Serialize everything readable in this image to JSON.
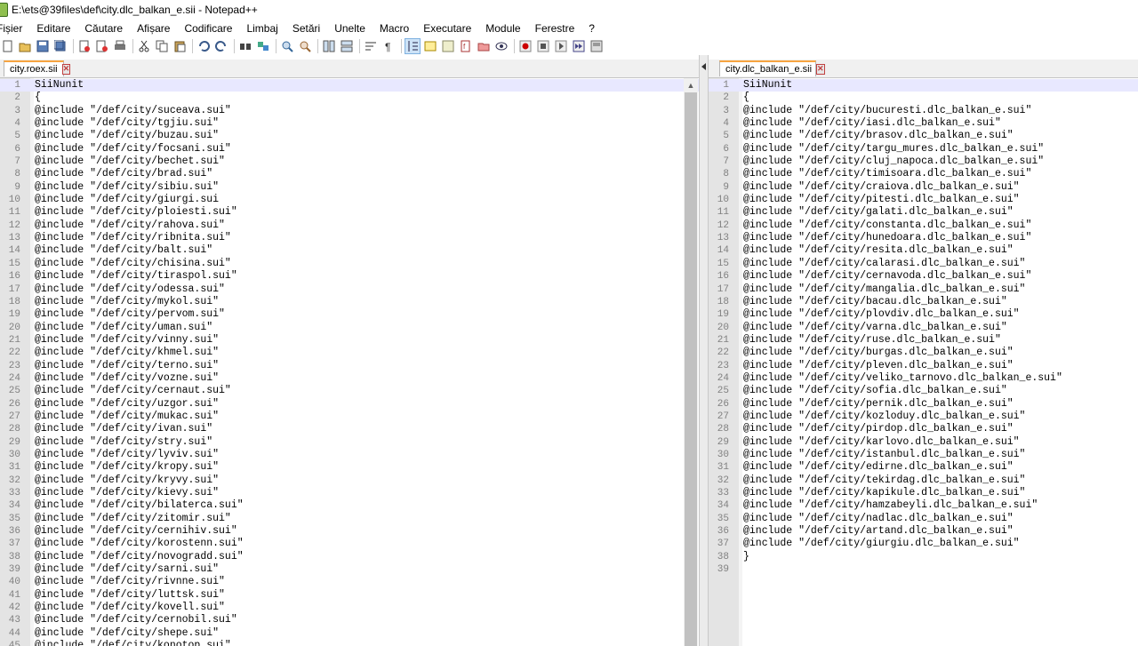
{
  "window": {
    "title": "E:\\ets@39files\\def\\city.dlc_balkan_e.sii - Notepad++"
  },
  "menu": [
    "Fișier",
    "Editare",
    "Căutare",
    "Afișare",
    "Codificare",
    "Limbaj",
    "Setări",
    "Unelte",
    "Macro",
    "Executare",
    "Module",
    "Ferestre",
    "?"
  ],
  "toolbar": [
    "new-icon",
    "open-icon",
    "save-icon",
    "save-all-icon",
    "close-icon",
    "close-all-icon",
    "print-icon",
    "cut-icon",
    "copy-icon",
    "paste-icon",
    "undo-icon",
    "redo-icon",
    "find-icon",
    "replace-icon",
    "zoom-in-icon",
    "zoom-out-icon",
    "sync-vertical-icon",
    "sync-horizontal-icon",
    "word-wrap-icon",
    "show-all-chars-icon",
    "indent-guide-icon",
    "udl-icon",
    "doc-map-icon",
    "function-list-icon",
    "folder-workspace-icon",
    "monitoring-icon",
    "record-macro-icon",
    "stop-macro-icon",
    "play-macro-icon",
    "run-macro-multiple-icon",
    "save-macro-icon"
  ],
  "left_pane": {
    "tab": "city.roex.sii",
    "lines": [
      "SiiNunit",
      "{",
      "@include \"/def/city/suceava.sui\"",
      "@include \"/def/city/tgjiu.sui\"",
      "@include \"/def/city/buzau.sui\"",
      "@include \"/def/city/focsani.sui\"",
      "@include \"/def/city/bechet.sui\"",
      "@include \"/def/city/brad.sui\"",
      "@include \"/def/city/sibiu.sui\"",
      "@include \"/def/city/giurgi.sui",
      "@include \"/def/city/ploiesti.sui\"",
      "@include \"/def/city/rahova.sui\"",
      "@include \"/def/city/ribnita.sui\"",
      "@include \"/def/city/balt.sui\"",
      "@include \"/def/city/chisina.sui\"",
      "@include \"/def/city/tiraspol.sui\"",
      "@include \"/def/city/odessa.sui\"",
      "@include \"/def/city/mykol.sui\"",
      "@include \"/def/city/pervom.sui\"",
      "@include \"/def/city/uman.sui\"",
      "@include \"/def/city/vinny.sui\"",
      "@include \"/def/city/khmel.sui\"",
      "@include \"/def/city/terno.sui\"",
      "@include \"/def/city/vozne.sui\"",
      "@include \"/def/city/cernaut.sui\"",
      "@include \"/def/city/uzgor.sui\"",
      "@include \"/def/city/mukac.sui\"",
      "@include \"/def/city/ivan.sui\"",
      "@include \"/def/city/stry.sui\"",
      "@include \"/def/city/lyviv.sui\"",
      "@include \"/def/city/kropy.sui\"",
      "@include \"/def/city/kryvy.sui\"",
      "@include \"/def/city/kievy.sui\"",
      "@include \"/def/city/bilaterca.sui\"",
      "@include \"/def/city/zitomir.sui\"",
      "@include \"/def/city/cernihiv.sui\"",
      "@include \"/def/city/korostenn.sui\"",
      "@include \"/def/city/novogradd.sui\"",
      "@include \"/def/city/sarni.sui\"",
      "@include \"/def/city/rivnne.sui\"",
      "@include \"/def/city/luttsk.sui\"",
      "@include \"/def/city/kovell.sui\"",
      "@include \"/def/city/cernobil.sui\"",
      "@include \"/def/city/shepe.sui\"",
      "@include \"/def/city/konotop.sui\""
    ]
  },
  "right_pane": {
    "tab": "city.dlc_balkan_e.sii",
    "lines": [
      "SiiNunit",
      "{",
      "@include \"/def/city/bucuresti.dlc_balkan_e.sui\"",
      "@include \"/def/city/iasi.dlc_balkan_e.sui\"",
      "@include \"/def/city/brasov.dlc_balkan_e.sui\"",
      "@include \"/def/city/targu_mures.dlc_balkan_e.sui\"",
      "@include \"/def/city/cluj_napoca.dlc_balkan_e.sui\"",
      "@include \"/def/city/timisoara.dlc_balkan_e.sui\"",
      "@include \"/def/city/craiova.dlc_balkan_e.sui\"",
      "@include \"/def/city/pitesti.dlc_balkan_e.sui\"",
      "@include \"/def/city/galati.dlc_balkan_e.sui\"",
      "@include \"/def/city/constanta.dlc_balkan_e.sui\"",
      "@include \"/def/city/hunedoara.dlc_balkan_e.sui\"",
      "@include \"/def/city/resita.dlc_balkan_e.sui\"",
      "@include \"/def/city/calarasi.dlc_balkan_e.sui\"",
      "@include \"/def/city/cernavoda.dlc_balkan_e.sui\"",
      "@include \"/def/city/mangalia.dlc_balkan_e.sui\"",
      "@include \"/def/city/bacau.dlc_balkan_e.sui\"",
      "@include \"/def/city/plovdiv.dlc_balkan_e.sui\"",
      "@include \"/def/city/varna.dlc_balkan_e.sui\"",
      "@include \"/def/city/ruse.dlc_balkan_e.sui\"",
      "@include \"/def/city/burgas.dlc_balkan_e.sui\"",
      "@include \"/def/city/pleven.dlc_balkan_e.sui\"",
      "@include \"/def/city/veliko_tarnovo.dlc_balkan_e.sui\"",
      "@include \"/def/city/sofia.dlc_balkan_e.sui\"",
      "@include \"/def/city/pernik.dlc_balkan_e.sui\"",
      "@include \"/def/city/kozloduy.dlc_balkan_e.sui\"",
      "@include \"/def/city/pirdop.dlc_balkan_e.sui\"",
      "@include \"/def/city/karlovo.dlc_balkan_e.sui\"",
      "@include \"/def/city/istanbul.dlc_balkan_e.sui\"",
      "@include \"/def/city/edirne.dlc_balkan_e.sui\"",
      "@include \"/def/city/tekirdag.dlc_balkan_e.sui\"",
      "@include \"/def/city/kapikule.dlc_balkan_e.sui\"",
      "@include \"/def/city/hamzabeyli.dlc_balkan_e.sui\"",
      "@include \"/def/city/nadlac.dlc_balkan_e.sui\"",
      "@include \"/def/city/artand.dlc_balkan_e.sui\"",
      "@include \"/def/city/giurgiu.dlc_balkan_e.sui\"",
      "}",
      ""
    ]
  }
}
